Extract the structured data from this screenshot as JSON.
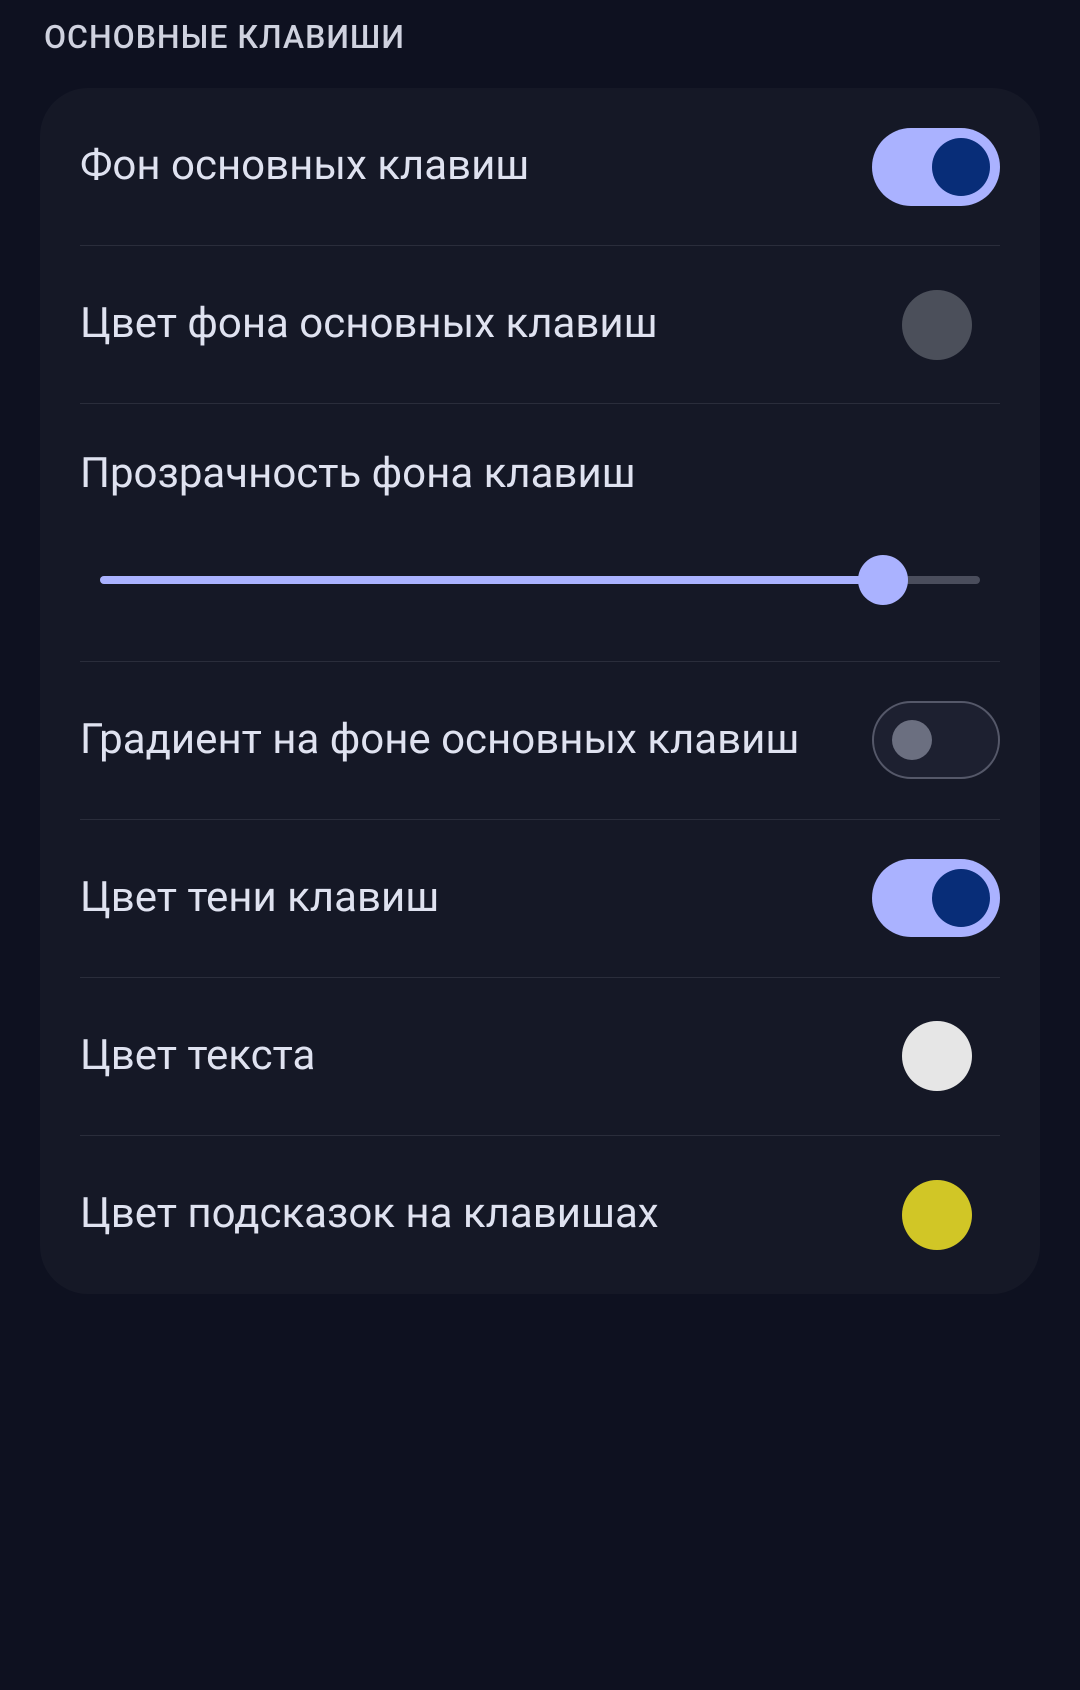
{
  "section_header": "ОСНОВНЫЕ КЛАВИШИ",
  "rows": {
    "bg_toggle": {
      "label": "Фон основных клавиш",
      "value": true
    },
    "bg_color": {
      "label": "Цвет фона основных клавиш",
      "color": "#4b4f5a"
    },
    "bg_opacity": {
      "label": "Прозрачность фона клавиш",
      "percent": 89
    },
    "gradient": {
      "label": "Градиент на фоне основных клавиш",
      "value": false
    },
    "shadow": {
      "label": "Цвет тени клавиш",
      "value": true
    },
    "text_color": {
      "label": "Цвет текста",
      "color": "#e6e6e6"
    },
    "hint_color": {
      "label": "Цвет подсказок на клавишах",
      "color": "#d1c626"
    }
  }
}
